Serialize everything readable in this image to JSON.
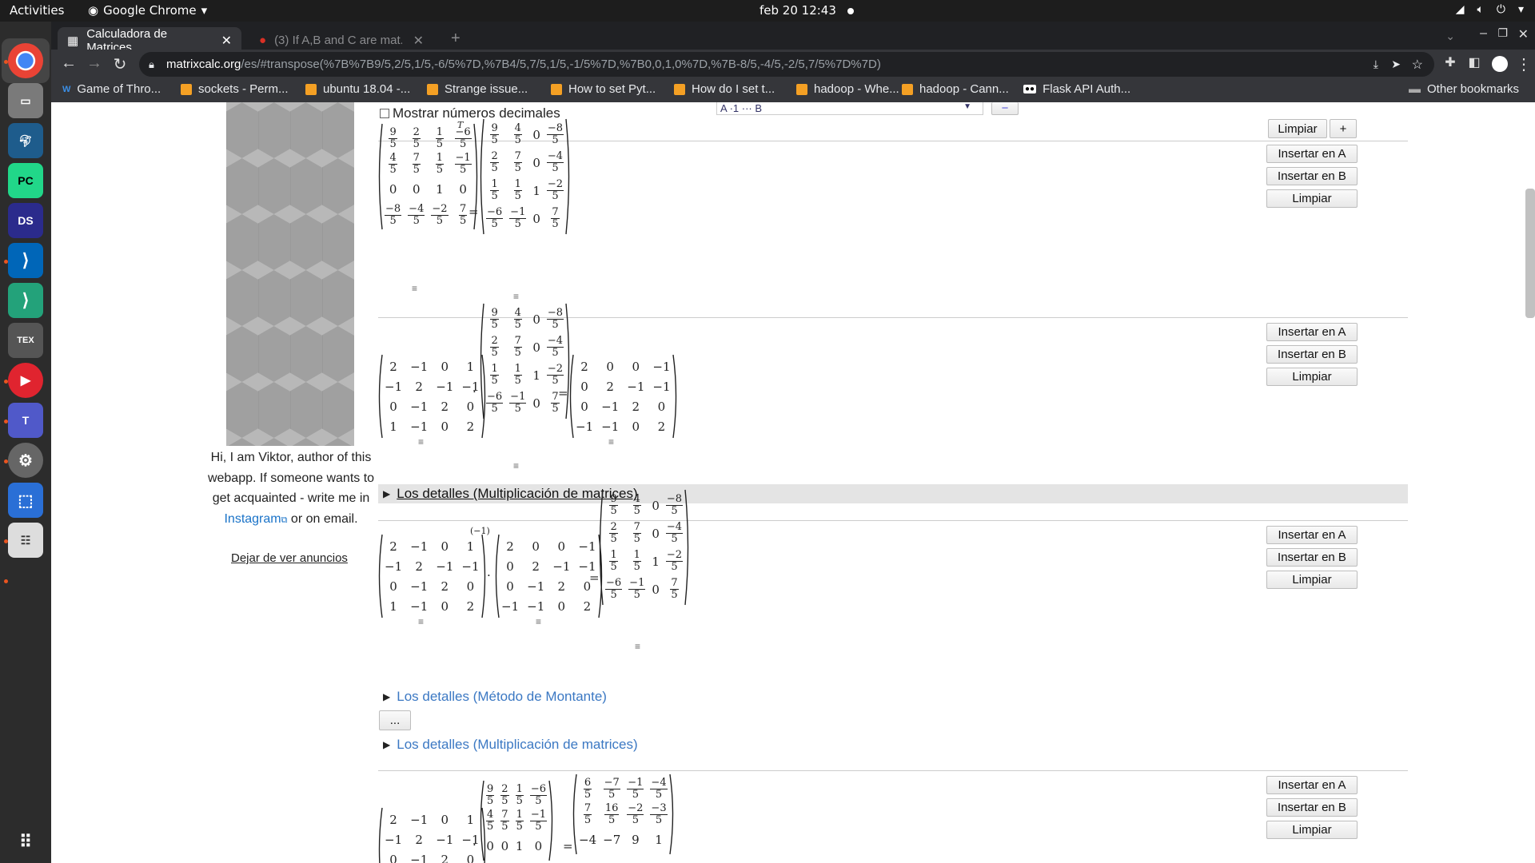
{
  "system": {
    "activities": "Activities",
    "app_name": "Google Chrome",
    "clock": "feb 20  12:43"
  },
  "browser": {
    "tabs": [
      {
        "title": "Calculadora de Matrices"
      },
      {
        "title": "(3) If A,B and C are mat..."
      }
    ],
    "url_host": "matrixcalc.org",
    "url_path": "/es/#transpose(%7B%7B9/5,2/5,1/5,-6/5%7D,%7B4/5,7/5,1/5,-1/5%7D,%7B0,0,1,0%7D,%7B-8/5,-4/5,-2/5,7/5%7D%7D)",
    "bookmarks": [
      "Game of Thro...",
      "sockets - Perm...",
      "ubuntu 18.04 -...",
      "Strange issue...",
      "How to set Pyt...",
      "How do I set t...",
      "hadoop - Whe...",
      "hadoop - Cann...",
      "Flask API Auth..."
    ],
    "other_bookmarks": "Other bookmarks"
  },
  "sidebar": {
    "author_text_1": "Hi, I am Viktor, author of this webapp. If someone wants to get acquainted - write me in",
    "instagram": "Instagram",
    "author_text_2": "or on email.",
    "stop_ads": "Dejar de ver anuncios"
  },
  "controls": {
    "decimals_label": "Mostrar números decimales",
    "clear": "Limpiar",
    "plus": "+",
    "insert_a": "Insertar en A",
    "insert_b": "Insertar en B",
    "ellipsis": "...",
    "selector_text": "A ·1 ··· B",
    "minus": "−"
  },
  "details": {
    "mult1": "Los detalles (Multiplicación de matrices)",
    "montante": "Los detalles (Método de Montante)",
    "mult2": "Los detalles (Multiplicación de matrices)"
  },
  "math": {
    "transpose_sup": "T",
    "inverse_sup": "(−1)",
    "equals": "=",
    "dot": "·",
    "equiv": "≡"
  },
  "matrices": {
    "A_T_src": [
      [
        "9/5",
        "2/5",
        "1/5",
        "-6/5"
      ],
      [
        "4/5",
        "7/5",
        "1/5",
        "-1/5"
      ],
      [
        "0",
        "0",
        "1",
        "0"
      ],
      [
        "-8/5",
        "-4/5",
        "-2/5",
        "7/5"
      ]
    ],
    "A_T_res": [
      [
        "9/5",
        "4/5",
        "0",
        "-8/5"
      ],
      [
        "2/5",
        "7/5",
        "0",
        "-4/5"
      ],
      [
        "1/5",
        "1/5",
        "1",
        "-2/5"
      ],
      [
        "-6/5",
        "-1/5",
        "0",
        "7/5"
      ]
    ],
    "M": [
      [
        "2",
        "−1",
        "0",
        "1"
      ],
      [
        "−1",
        "2",
        "−1",
        "−1"
      ],
      [
        "0",
        "−1",
        "2",
        "0"
      ],
      [
        "1",
        "−1",
        "0",
        "2"
      ]
    ],
    "P": [
      [
        "2",
        "0",
        "0",
        "−1"
      ],
      [
        "0",
        "2",
        "−1",
        "−1"
      ],
      [
        "0",
        "−1",
        "2",
        "0"
      ],
      [
        "−1",
        "−1",
        "0",
        "2"
      ]
    ],
    "Q": [
      [
        "9/5",
        "2/5",
        "1/5",
        "-6/5"
      ],
      [
        "4/5",
        "7/5",
        "1/5",
        "-1/5"
      ],
      [
        "0",
        "0",
        "1",
        "0"
      ]
    ],
    "R": [
      [
        "6/5",
        "-7/5",
        "-1/5",
        "-4/5"
      ],
      [
        "7/5",
        "16/5",
        "-2/5",
        "-3/5"
      ],
      [
        "-4",
        "-7",
        "9",
        "1"
      ]
    ]
  }
}
